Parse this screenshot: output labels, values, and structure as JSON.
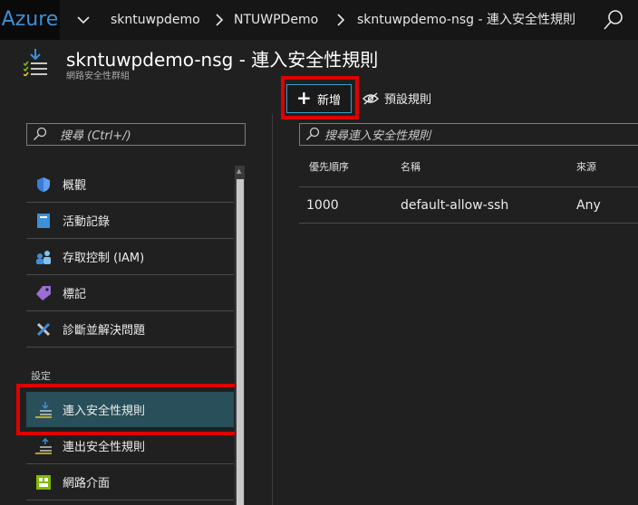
{
  "topbar": {
    "brand": "Azure",
    "breadcrumbs": [
      "skntuwpdemo",
      "NTUWPDemo",
      "skntuwpdemo-nsg - 連入安全性規則"
    ],
    "search_icon": "search-icon"
  },
  "blade": {
    "title": "skntuwpdemo-nsg - 連入安全性規則",
    "subtitle": "網路安全性群組"
  },
  "nav": {
    "search_placeholder": "搜尋 (Ctrl+/)",
    "items": [
      {
        "label": "概觀",
        "icon": "shield-icon"
      },
      {
        "label": "活動記錄",
        "icon": "activity-log-icon"
      },
      {
        "label": "存取控制 (IAM)",
        "icon": "people-icon"
      },
      {
        "label": "標記",
        "icon": "tag-icon"
      },
      {
        "label": "診斷並解決問題",
        "icon": "wrench-icon"
      }
    ],
    "section": "設定",
    "settings_items": [
      {
        "label": "連入安全性規則",
        "icon": "inbound-rules-icon",
        "active": true
      },
      {
        "label": "連出安全性規則",
        "icon": "outbound-rules-icon"
      },
      {
        "label": "網路介面",
        "icon": "network-interface-icon"
      }
    ]
  },
  "commands": {
    "add_label": "新增",
    "default_rules_label": "預設規則"
  },
  "rules": {
    "search_placeholder": "搜尋連入安全性規則",
    "columns": [
      "優先順序",
      "名稱",
      "來源"
    ],
    "rows": [
      [
        "1000",
        "default-allow-ssh",
        "Any"
      ]
    ]
  },
  "colors": {
    "accent": "#3aa0c8",
    "highlight": "#e00000",
    "active_bg": "#284f5a"
  }
}
